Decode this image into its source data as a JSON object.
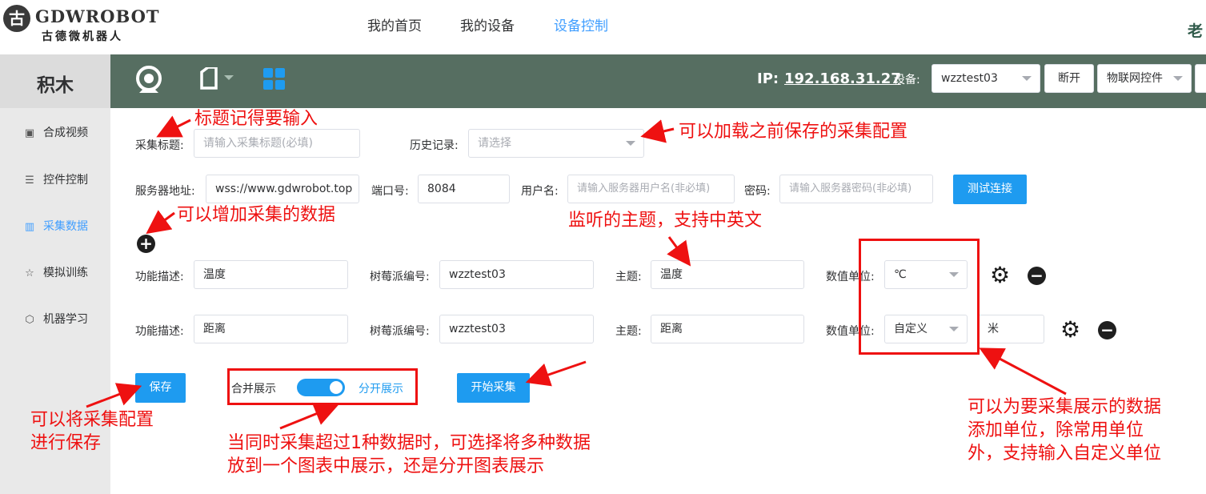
{
  "brand": {
    "name": "GDWROBOT",
    "subtitle": "古德微机器人",
    "mark": "古"
  },
  "nav": {
    "home": "我的首页",
    "devices": "我的设备",
    "control": "设备控制",
    "user_fragment": "老"
  },
  "sidebar": {
    "title": "积木",
    "items": [
      {
        "label": "合成视频",
        "icon": "image-icon"
      },
      {
        "label": "控件控制",
        "icon": "sliders-icon"
      },
      {
        "label": "采集数据",
        "icon": "chart-icon"
      },
      {
        "label": "模拟训练",
        "icon": "star-icon"
      },
      {
        "label": "机器学习",
        "icon": "cube-icon"
      }
    ]
  },
  "header": {
    "ip_label": "IP:",
    "ip_value": "192.168.31.27",
    "device_label": "设备:",
    "device_value": "wzztest03",
    "disconnect": "断开",
    "iot_control": "物联网控件"
  },
  "form": {
    "title_label": "采集标题:",
    "title_placeholder": "请输入采集标题(必填)",
    "history_label": "历史记录:",
    "history_placeholder": "请选择",
    "server_label": "服务器地址:",
    "server_value": "wss://www.gdwrobot.top",
    "port_label": "端口号:",
    "port_value": "8084",
    "user_label": "用户名:",
    "user_placeholder": "请输入服务器用户名(非必填)",
    "pwd_label": "密码:",
    "pwd_placeholder": "请输入服务器密码(非必填)",
    "test_button": "测试连接",
    "add_symbol": "+",
    "rows": [
      {
        "func_label": "功能描述:",
        "func_value": "温度",
        "pi_label": "树莓派编号:",
        "pi_value": "wzztest03",
        "topic_label": "主题:",
        "topic_value": "温度",
        "unit_label": "数值单位:",
        "unit_value": "℃",
        "custom_unit": ""
      },
      {
        "func_label": "功能描述:",
        "func_value": "距离",
        "pi_label": "树莓派编号:",
        "pi_value": "wzztest03",
        "topic_label": "主题:",
        "topic_value": "距离",
        "unit_label": "数值单位:",
        "unit_value": "自定义",
        "custom_unit": "米"
      }
    ],
    "save_button": "保存",
    "merge_label": "合并展示",
    "split_label": "分开展示",
    "start_button": "开始采集"
  },
  "annotations": {
    "title": "标题记得要输入",
    "history": "可以加载之前保存的采集配置",
    "add": "可以增加采集的数据",
    "topic": "监听的主题，支持中英文",
    "save_line1": "可以将采集配置",
    "save_line2": "进行保存",
    "switch_line1": "当同时采集超过1种数据时，可选择将多种数据",
    "switch_line2": "放到一个图表中展示，还是分开图表展示",
    "unit_line1": "可以为要采集展示的数据",
    "unit_line2": "添加单位，除常用单位",
    "unit_line3": "外，支持输入自定义单位"
  },
  "colors": {
    "accent": "#1e9bf0",
    "header_bg": "#566e61",
    "annotation": "#ee1111"
  }
}
